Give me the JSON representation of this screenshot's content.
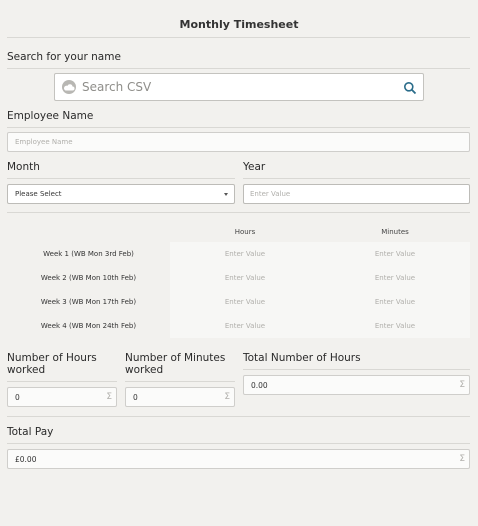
{
  "form": {
    "title": "Monthly Timesheet"
  },
  "search": {
    "label": "Search for your name",
    "placeholder": "Search CSV"
  },
  "employee": {
    "label": "Employee Name",
    "placeholder": "Employee Name"
  },
  "month": {
    "label": "Month",
    "selected": "Please Select"
  },
  "year": {
    "label": "Year",
    "placeholder": "Enter Value"
  },
  "matrix": {
    "columns": [
      "Hours",
      "Minutes"
    ],
    "rows": [
      {
        "label": "Week 1 (WB Mon 3rd Feb)",
        "hours": "Enter Value",
        "minutes": "Enter Value"
      },
      {
        "label": "Week 2 (WB Mon 10th Feb)",
        "hours": "Enter Value",
        "minutes": "Enter Value"
      },
      {
        "label": "Week 3 (WB Mon 17th Feb)",
        "hours": "Enter Value",
        "minutes": "Enter Value"
      },
      {
        "label": "Week 4 (WB Mon 24th Feb)",
        "hours": "Enter Value",
        "minutes": "Enter Value"
      }
    ]
  },
  "totals": {
    "hours_worked_label_1": "Number of Hours",
    "hours_worked_label_2": "worked",
    "hours_worked_value": "0",
    "minutes_worked_label_1": "Number of Minutes",
    "minutes_worked_label_2": "worked",
    "minutes_worked_value": "0",
    "total_hours_label": "Total Number of Hours",
    "total_hours_value": "0.00",
    "sigma": "Σ"
  },
  "pay": {
    "label": "Total Pay",
    "value": "£0.00"
  },
  "icons": {
    "search_left": "cloud-icon",
    "search_right": "search-icon",
    "dropdown": "caret-down-icon"
  }
}
